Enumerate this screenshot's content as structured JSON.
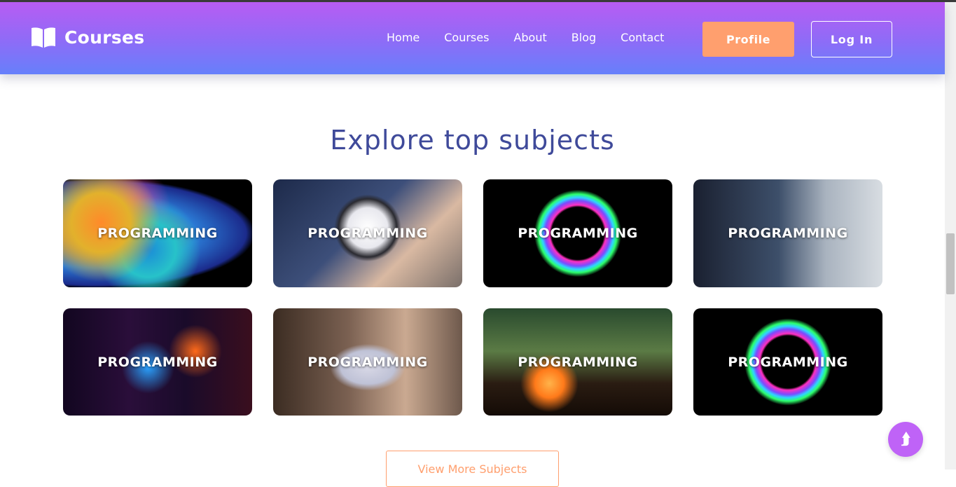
{
  "brand": {
    "name": "Courses",
    "icon": "open-book-icon"
  },
  "nav": {
    "links": [
      "Home",
      "Courses",
      "About",
      "Blog",
      "Contact"
    ],
    "profile_label": "Profile",
    "login_label": "Log In"
  },
  "section": {
    "title": "Explore top subjects"
  },
  "subjects": [
    {
      "label": "PROGRAMMING"
    },
    {
      "label": "PROGRAMMING"
    },
    {
      "label": "PROGRAMMING"
    },
    {
      "label": "PROGRAMMING"
    },
    {
      "label": "PROGRAMMING"
    },
    {
      "label": "PROGRAMMING"
    },
    {
      "label": "PROGRAMMING"
    },
    {
      "label": "PROGRAMMING"
    }
  ],
  "view_more_label": "View More Subjects",
  "scroll_top": {
    "icon": "arrow-up-icon",
    "glyph": "⮭"
  },
  "colors": {
    "nav_gradient_top": "#b85cf3",
    "nav_gradient_bottom": "#6680fb",
    "accent_orange": "#ff9f6e",
    "title_blue": "#3f4a9a",
    "scroll_button": "#bf63f7"
  }
}
